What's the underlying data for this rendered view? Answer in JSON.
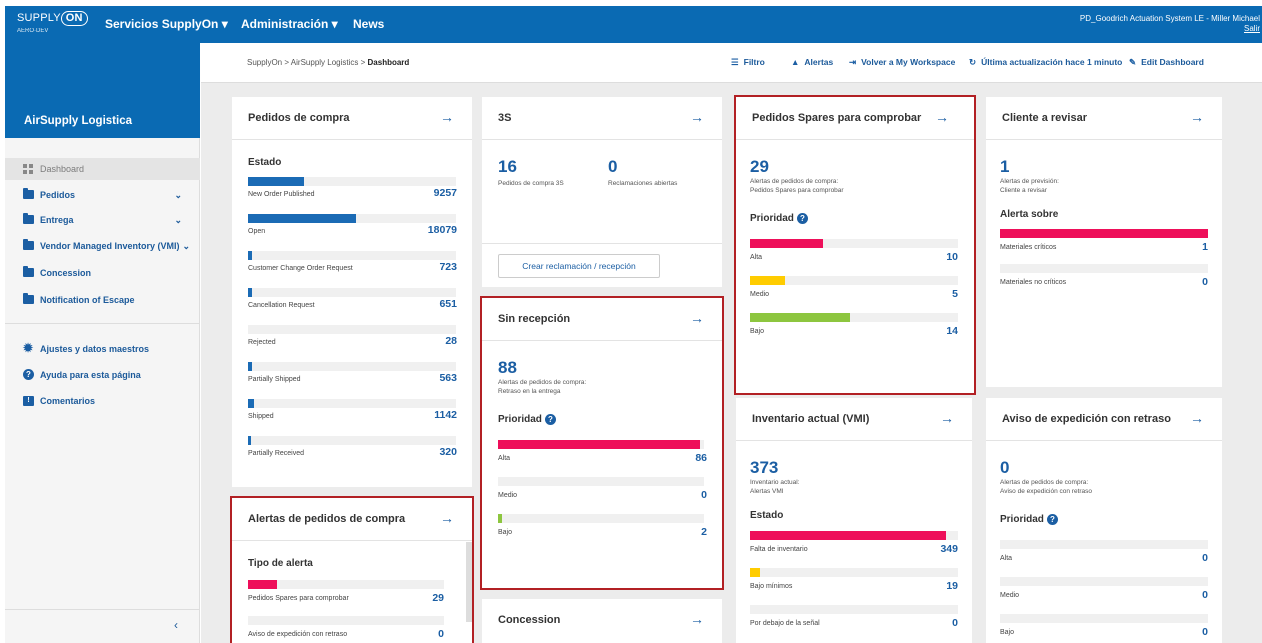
{
  "topbar": {
    "logo_text": "SUPPLY",
    "logo_ring": "ON",
    "logo_sub": "AERO·DEV",
    "nav": [
      "Servicios SupplyOn ▾",
      "Administración ▾",
      "News"
    ],
    "user": "PD_Goodrich Actuation System LE - Miller Michael",
    "logout": "Salir"
  },
  "sidebar": {
    "title": "AirSupply Logistica",
    "items": [
      {
        "label": "Dashboard",
        "icon": "dashboard-icon",
        "active": true
      },
      {
        "label": "Pedidos",
        "icon": "folder-icon",
        "expand": "⌄"
      },
      {
        "label": "Entrega",
        "icon": "folder-icon",
        "expand": "⌄"
      },
      {
        "label": "Vendor Managed Inventory (VMI)",
        "icon": "folder-icon",
        "expand": "⌄"
      },
      {
        "label": "Concession",
        "icon": "folder-icon"
      },
      {
        "label": "Notification of Escape",
        "icon": "folder-icon"
      }
    ],
    "items2": [
      {
        "label": "Ajustes y datos maestros",
        "icon": "gear-icon"
      },
      {
        "label": "Ayuda para esta página",
        "icon": "help-icon"
      },
      {
        "label": "Comentarios",
        "icon": "comment-icon"
      }
    ],
    "collapse": "‹"
  },
  "breadcrumb": {
    "path": "SupplyOn  >  AirSupply Logistics  >  ",
    "current": "Dashboard"
  },
  "toolbar": {
    "filter": "Filtro",
    "alerts": "Alertas",
    "workspace": "Volver a My Workspace",
    "updated": "Última actualización hace 1 minuto",
    "edit": "Edit Dashboard"
  },
  "colors": {
    "primary": "#0a6ab3",
    "blue_bar": "#1b6bb5",
    "red": "#ee0f5a",
    "yellow": "#ffcc00",
    "green": "#8dc63f",
    "highlight": "#b22024"
  },
  "cards": {
    "pedidos_compra": {
      "title": "Pedidos de compra",
      "arrow": "→",
      "section": "Estado",
      "rows": [
        {
          "label": "New Order Published",
          "value": "9257",
          "pct": 0.27
        },
        {
          "label": "Open",
          "value": "18079",
          "pct": 0.52
        },
        {
          "label": "Customer Change Order Request",
          "value": "723",
          "pct": 0.02
        },
        {
          "label": "Cancellation Request",
          "value": "651",
          "pct": 0.02
        },
        {
          "label": "Rejected",
          "value": "28",
          "pct": 0.0
        },
        {
          "label": "Partially Shipped",
          "value": "563",
          "pct": 0.02
        },
        {
          "label": "Shipped",
          "value": "1142",
          "pct": 0.03
        },
        {
          "label": "Partially Received",
          "value": "320",
          "pct": 0.01
        }
      ]
    },
    "tres_s": {
      "title": "3S",
      "arrow": "→",
      "n1": "16",
      "l1": "Pedidos de compra 3S",
      "n2": "0",
      "l2": "Reclamaciones abiertas",
      "button": "Crear reclamación / recepción"
    },
    "spares": {
      "title": "Pedidos Spares para comprobar",
      "arrow": "→",
      "count": "29",
      "desc1": "Alertas de pedidos de compra:",
      "desc2": "Pedidos Spares para comprobar",
      "section": "Prioridad",
      "help": "?",
      "rows": [
        {
          "label": "Alta",
          "value": "10",
          "pct": 0.35,
          "color": "#ee0f5a"
        },
        {
          "label": "Medio",
          "value": "5",
          "pct": 0.17,
          "color": "#ffcc00"
        },
        {
          "label": "Bajo",
          "value": "14",
          "pct": 0.48,
          "color": "#8dc63f"
        }
      ]
    },
    "cliente": {
      "title": "Cliente a revisar",
      "arrow": "→",
      "count": "1",
      "desc1": "Alertas de previsión:",
      "desc2": "Cliente a revisar",
      "section": "Alerta sobre",
      "rows": [
        {
          "label": "Materiales críticos",
          "value": "1",
          "pct": 1.0,
          "color": "#ee0f5a"
        },
        {
          "label": "Materiales no críticos",
          "value": "0",
          "pct": 0.0,
          "color": "#ee0f5a"
        }
      ]
    },
    "sin_recepcion": {
      "title": "Sin recepción",
      "arrow": "→",
      "count": "88",
      "desc1": "Alertas de pedidos de compra:",
      "desc2": "Retraso en la entrega",
      "section": "Prioridad",
      "help": "?",
      "rows": [
        {
          "label": "Alta",
          "value": "86",
          "pct": 0.98,
          "color": "#ee0f5a"
        },
        {
          "label": "Medio",
          "value": "0",
          "pct": 0.0,
          "color": "#ffcc00"
        },
        {
          "label": "Bajo",
          "value": "2",
          "pct": 0.02,
          "color": "#8dc63f"
        }
      ]
    },
    "alertas_pedidos": {
      "title": "Alertas de pedidos de compra",
      "arrow": "→",
      "section": "Tipo de alerta",
      "rows": [
        {
          "label": "Pedidos Spares para comprobar",
          "value": "29",
          "pct": 0.15,
          "color": "#ee0f5a"
        },
        {
          "label": "Aviso de expedición con retraso",
          "value": "0",
          "pct": 0.0,
          "color": "#ee0f5a"
        }
      ]
    },
    "inventario": {
      "title": "Inventario actual (VMI)",
      "arrow": "→",
      "count": "373",
      "desc1": "Inventario actual:",
      "desc2": "Alertas VMI",
      "section": "Estado",
      "rows": [
        {
          "label": "Falta de inventario",
          "value": "349",
          "pct": 0.94,
          "color": "#ee0f5a"
        },
        {
          "label": "Bajo mínimos",
          "value": "19",
          "pct": 0.05,
          "color": "#ffcc00"
        },
        {
          "label": "Por debajo de la señal",
          "value": "0",
          "pct": 0.0,
          "color": "#8dc63f"
        }
      ]
    },
    "aviso_exp": {
      "title": "Aviso de expedición con retraso",
      "arrow": "→",
      "count": "0",
      "desc1": "Alertas de pedidos de compra:",
      "desc2": "Aviso de expedición con retraso",
      "section": "Prioridad",
      "help": "?",
      "rows": [
        {
          "label": "Alta",
          "value": "0",
          "pct": 0.0,
          "color": "#ee0f5a"
        },
        {
          "label": "Medio",
          "value": "0",
          "pct": 0.0,
          "color": "#ffcc00"
        },
        {
          "label": "Bajo",
          "value": "0",
          "pct": 0.0,
          "color": "#8dc63f"
        }
      ]
    },
    "concession": {
      "title": "Concession",
      "arrow": "→"
    }
  }
}
